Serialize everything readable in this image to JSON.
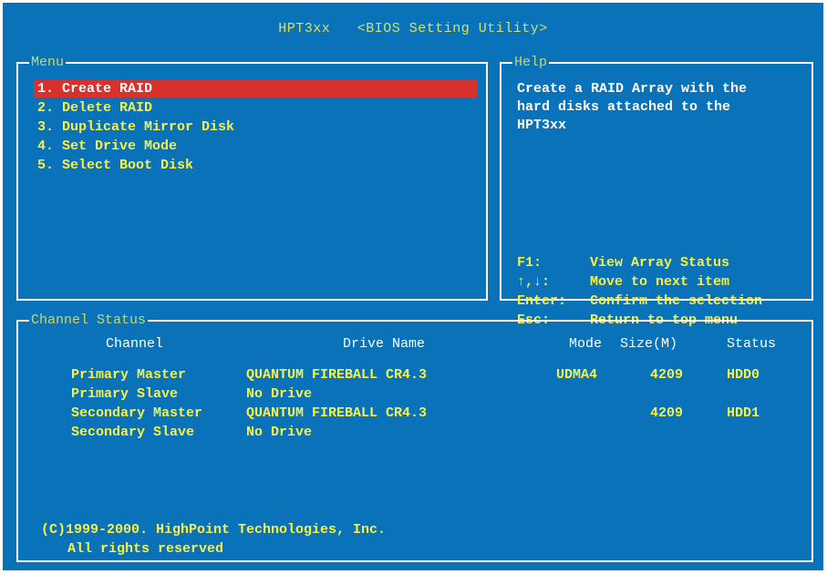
{
  "header": {
    "app_name": "HPT3xx",
    "utility_name": "<BIOS Setting Utility>"
  },
  "menu": {
    "label": "Menu",
    "items": [
      {
        "label": "1. Create RAID",
        "selected": true
      },
      {
        "label": "2. Delete RAID"
      },
      {
        "label": "3. Duplicate Mirror Disk"
      },
      {
        "label": "4. Set Drive Mode"
      },
      {
        "label": "5. Select Boot Disk"
      }
    ]
  },
  "help": {
    "label": "Help",
    "lines": [
      "Create a RAID Array with the",
      "hard disks attached to the",
      "HPT3xx"
    ],
    "keys": [
      {
        "key": "F1:",
        "desc": "View Array Status"
      },
      {
        "key": "↑,↓:",
        "desc": "Move to next item"
      },
      {
        "key": "Enter:",
        "desc": "Confirm the selection"
      },
      {
        "key": "Esc:",
        "desc": "Return to top menu"
      }
    ]
  },
  "channel_status": {
    "label": "Channel Status",
    "columns": {
      "channel": "Channel",
      "drive": "Drive Name",
      "mode": "Mode",
      "size": "Size(M)",
      "status": "Status"
    },
    "rows": [
      {
        "channel": "Primary Master",
        "drive": "QUANTUM FIREBALL CR4.3",
        "mode": "UDMA4",
        "size": "4209",
        "status": "HDD0"
      },
      {
        "channel": "Primary Slave",
        "drive": "No Drive",
        "mode": "",
        "size": "",
        "status": ""
      },
      {
        "channel": "Secondary Master",
        "drive": "QUANTUM FIREBALL CR4.3",
        "mode": "",
        "size": "4209",
        "status": "HDD1"
      },
      {
        "channel": "Secondary Slave",
        "drive": "No Drive",
        "mode": "",
        "size": "",
        "status": ""
      }
    ]
  },
  "footer": {
    "copyright": "(C)1999-2000. HighPoint Technologies, Inc.",
    "rights": "All rights reserved"
  },
  "colors": {
    "background": "#0a72b8",
    "highlight": "#d8302a",
    "text_yellow": "#f7f04a",
    "border": "#ffffff"
  }
}
